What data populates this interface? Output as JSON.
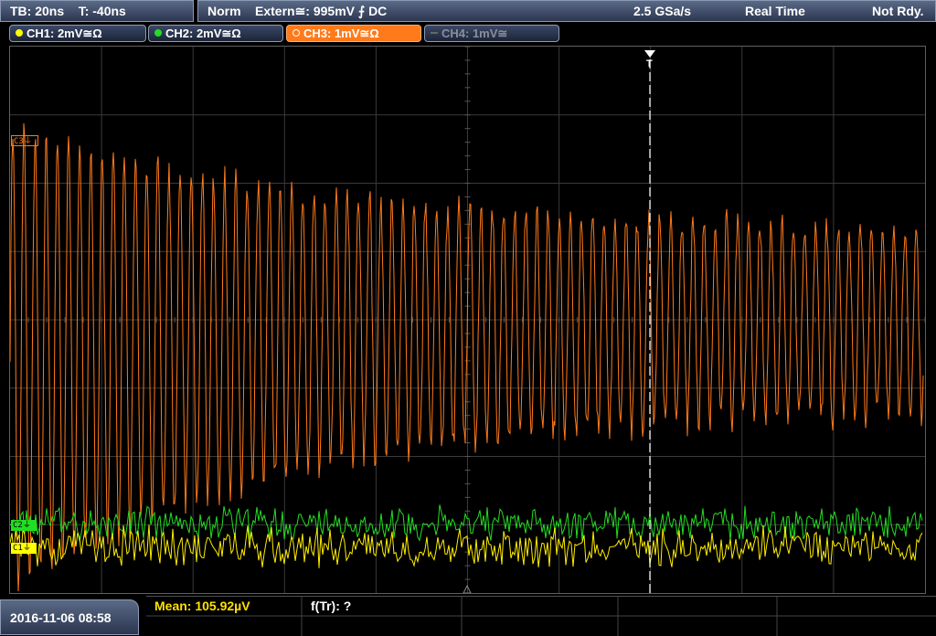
{
  "top_left": {
    "timebase": "TB: 20ns",
    "trigger_time": "T: -40ns"
  },
  "top_right": {
    "mode": "Norm",
    "trigger_source": "Extern≅: 995mV ⨍ DC",
    "sample_rate": "2.5 GSa/s",
    "acq_mode": "Real Time",
    "status": "Not Rdy."
  },
  "channels": [
    {
      "label": "CH1: 2mV≅Ω",
      "color": "#ffff00",
      "state": "on"
    },
    {
      "label": "CH2: 2mV≅Ω",
      "color": "#22dd22",
      "state": "on"
    },
    {
      "label": "CH3: 1mV≅Ω",
      "color": "#ff7a1a",
      "state": "active"
    },
    {
      "label": "CH4: 1mV≅",
      "color": "#888888",
      "state": "off"
    }
  ],
  "markers": {
    "ch3": "C3",
    "ch2": "C2",
    "ch1": "C1",
    "trigger": "T"
  },
  "colors": {
    "ch1": "#ffff00",
    "ch2": "#22dd22",
    "ch3": "#ff7a1a"
  },
  "timestamp": "2016-11-06 08:58",
  "measurements": {
    "mean": "Mean: 105.92µV",
    "rise_freq": "f(Tr): ?"
  }
}
